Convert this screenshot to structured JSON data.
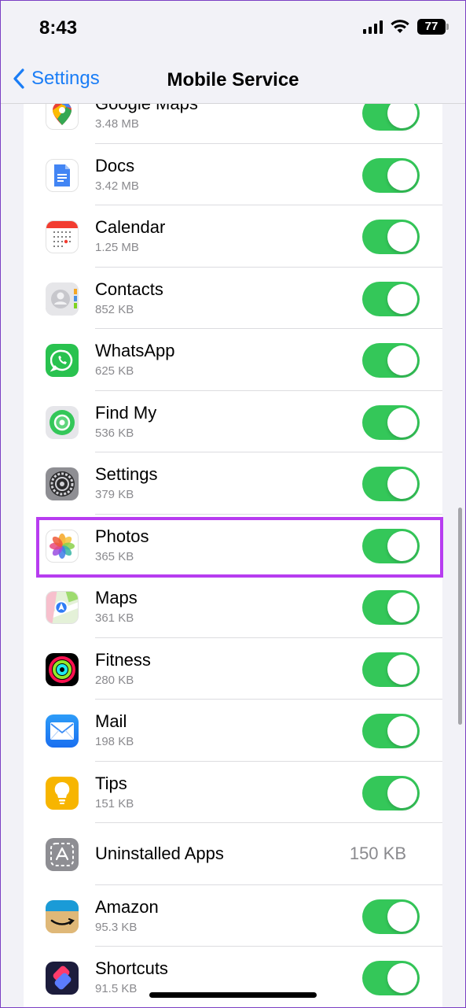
{
  "status_bar": {
    "time": "8:43",
    "battery": "77"
  },
  "nav": {
    "back_label": "Settings",
    "title": "Mobile Service"
  },
  "apps": [
    {
      "name": "Google Maps",
      "size": "3.48 MB",
      "toggle": true,
      "icon": "google-maps-icon"
    },
    {
      "name": "Docs",
      "size": "3.42 MB",
      "toggle": true,
      "icon": "docs-icon"
    },
    {
      "name": "Calendar",
      "size": "1.25 MB",
      "toggle": true,
      "icon": "calendar-icon"
    },
    {
      "name": "Contacts",
      "size": "852 KB",
      "toggle": true,
      "icon": "contacts-icon"
    },
    {
      "name": "WhatsApp",
      "size": "625 KB",
      "toggle": true,
      "icon": "whatsapp-icon"
    },
    {
      "name": "Find My",
      "size": "536 KB",
      "toggle": true,
      "icon": "find-my-icon"
    },
    {
      "name": "Settings",
      "size": "379 KB",
      "toggle": true,
      "icon": "settings-icon"
    },
    {
      "name": "Photos",
      "size": "365 KB",
      "toggle": true,
      "icon": "photos-icon",
      "highlighted": true
    },
    {
      "name": "Maps",
      "size": "361 KB",
      "toggle": true,
      "icon": "maps-icon"
    },
    {
      "name": "Fitness",
      "size": "280 KB",
      "toggle": true,
      "icon": "fitness-icon"
    },
    {
      "name": "Mail",
      "size": "198 KB",
      "toggle": true,
      "icon": "mail-icon"
    },
    {
      "name": "Tips",
      "size": "151 KB",
      "toggle": true,
      "icon": "tips-icon"
    },
    {
      "name": "Uninstalled Apps",
      "size": "150 KB",
      "toggle": false,
      "icon": "app-store-icon"
    },
    {
      "name": "Amazon",
      "size": "95.3 KB",
      "toggle": true,
      "icon": "amazon-icon"
    },
    {
      "name": "Shortcuts",
      "size": "91.5 KB",
      "toggle": true,
      "icon": "shortcuts-icon"
    }
  ],
  "colors": {
    "accent": "#1a7df6",
    "toggle_on": "#34c759",
    "highlight": "#b73cf0"
  }
}
